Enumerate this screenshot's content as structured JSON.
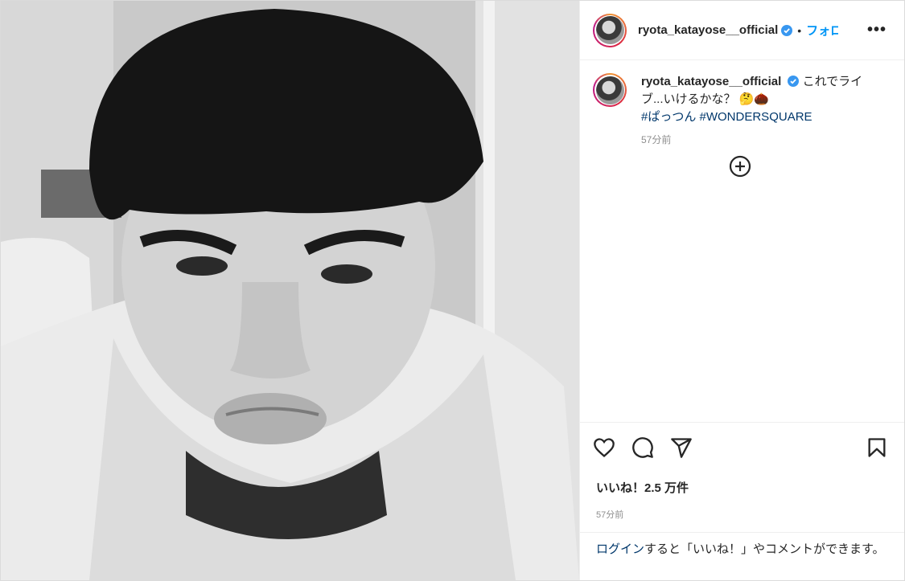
{
  "post": {
    "username": "ryota_katayose__official",
    "follow_label": "フォロー",
    "separator": "•",
    "caption_text": "これでライブ...いけるかな？ 🤔🌰",
    "hashtags": [
      "#ぱっつん",
      "#WONDERSQUARE"
    ],
    "caption_time": "57分前",
    "likes_label": "いいね！2.5 万件",
    "posted_time": "57分前",
    "login_link": "ログイン",
    "login_rest": "すると「いいね！」やコメントができます。"
  },
  "icons": {
    "verified": "verified-badge-icon",
    "more": "more-options-icon",
    "load_more": "plus-circle-icon",
    "like": "heart-icon",
    "comment": "comment-icon",
    "share": "share-icon",
    "save": "bookmark-icon"
  },
  "colors": {
    "link_blue": "#0095f6",
    "hashtag_blue": "#00376b",
    "muted_text": "#8e8e8e",
    "verified_blue": "#3897f0"
  }
}
